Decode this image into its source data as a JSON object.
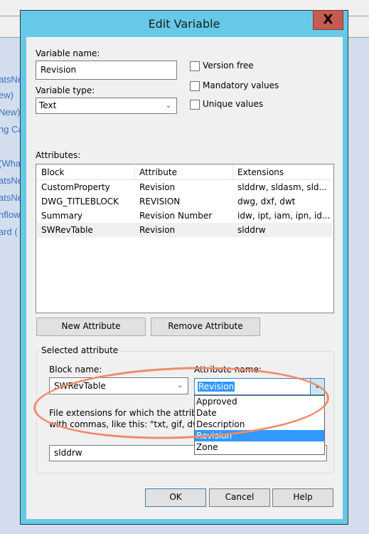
{
  "background": {
    "links": [
      "atsNe",
      "ew)",
      "New)",
      "ng Ca",
      "(Wha",
      "atsNe",
      "atsNe",
      "nflow",
      "ard  ("
    ]
  },
  "dialog": {
    "title": "Edit Variable",
    "close_icon": "close-icon",
    "close_glyph": "X",
    "variable_name_label": "Variable name:",
    "variable_name_value": "Revision",
    "variable_type_label": "Variable type:",
    "variable_type_value": "Text",
    "checkboxes": [
      {
        "label": "Version free",
        "checked": false
      },
      {
        "label": "Mandatory values",
        "checked": false
      },
      {
        "label": "Unique values",
        "checked": false
      }
    ],
    "attributes_label": "Attributes:",
    "attributes_table": {
      "columns": [
        "Block",
        "Attribute",
        "Extensions"
      ],
      "rows": [
        {
          "block": "CustomProperty",
          "attribute": "Revision",
          "extensions": "slddrw, sldasm, sld..."
        },
        {
          "block": "DWG_TITLEBLOCK",
          "attribute": "REVISION",
          "extensions": "dwg, dxf, dwt"
        },
        {
          "block": "Summary",
          "attribute": "Revision Number",
          "extensions": "idw, ipt, iam, ipn, id..."
        },
        {
          "block": "SWRevTable",
          "attribute": "Revision",
          "extensions": "slddrw",
          "selected": true
        }
      ]
    },
    "new_attribute_button": "New Attribute",
    "remove_attribute_button": "Remove Attribute",
    "selected_attribute": {
      "group_title": "Selected attribute",
      "block_name_label": "Block name:",
      "block_name_value": "SWRevTable",
      "attribute_name_label": "Attribute name:",
      "attribute_name_value": "Revision",
      "attribute_options": [
        "Approved",
        "Date",
        "Description",
        "Revision",
        "Zone"
      ],
      "attribute_selected_index": 3,
      "extensions_label_line1": "File extensions for which the attribute is valid, separated",
      "extensions_label_line2": "with commas, like this: \"txt, gif, dwg\"",
      "extensions_value": "slddrw"
    },
    "ok_button": "OK",
    "cancel_button": "Cancel",
    "help_button": "Help",
    "highlight_color": "#f08b6a",
    "accent_color": "#66c9e8"
  }
}
